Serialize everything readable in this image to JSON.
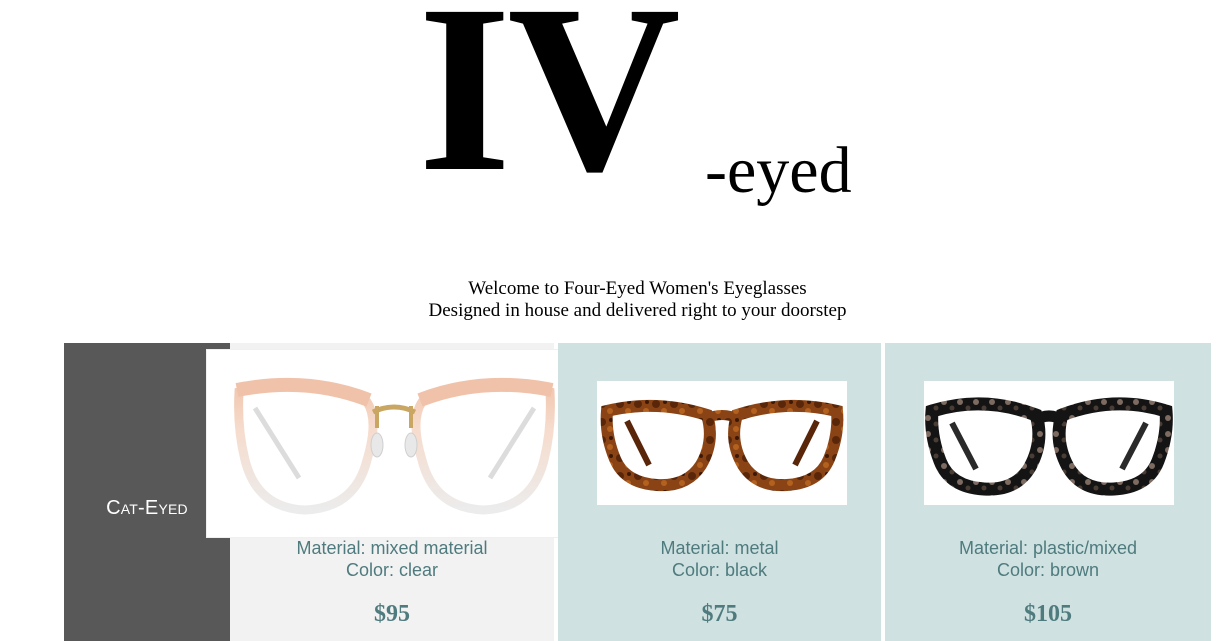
{
  "logo": {
    "main": "IV",
    "suffix": "-eyed"
  },
  "welcome": {
    "line1": "Welcome to Four-Eyed Women's Eyeglasses",
    "line2": "Designed in house and delivered right to your doorstep"
  },
  "category": {
    "label": "Cat-Eyed"
  },
  "products": [
    {
      "material": "Material: mixed material",
      "color": "Color: clear",
      "price": "$95",
      "image": "clear-rose-cat-eye-glasses"
    },
    {
      "material": "Material: metal",
      "color": "Color: black",
      "price": "$75",
      "image": "tortoise-cat-eye-glasses"
    },
    {
      "material": "Material: plastic/mixed",
      "color": "Color: brown",
      "price": "$105",
      "image": "black-tortoise-cat-eye-glasses"
    }
  ],
  "colors": {
    "sidebar": "#585858",
    "card_light": "#f2f2f2",
    "card_teal": "#cfe1e1",
    "text_teal": "#4f7b7e"
  }
}
